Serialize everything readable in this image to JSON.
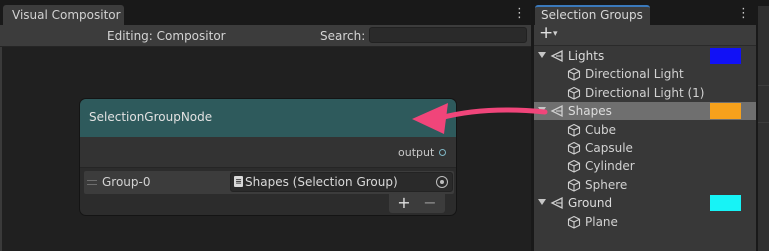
{
  "compositor": {
    "tab_label": "Visual Compositor",
    "menu_icon": "kebab-icon",
    "editing_label": "Editing: Compositor",
    "search_label": "Search:",
    "search_value": "",
    "node": {
      "title": "SelectionGroupNode",
      "output_label": "output",
      "group_label": "Group-0",
      "field_value": "Shapes (Selection Group)",
      "add_label": "+",
      "remove_label": "−"
    }
  },
  "selection_groups": {
    "tab_label": "Selection Groups",
    "menu_icon": "kebab-icon",
    "add_label": "+",
    "add_caret": "▾",
    "groups": [
      {
        "label": "Lights",
        "color": "#1111f6",
        "selected": false,
        "items": [
          "Directional Light",
          "Directional Light (1)"
        ]
      },
      {
        "label": "Shapes",
        "color": "#f6a11c",
        "selected": true,
        "items": [
          "Cube",
          "Capsule",
          "Cylinder",
          "Sphere"
        ]
      },
      {
        "label": "Ground",
        "color": "#17f3f6",
        "selected": false,
        "items": [
          "Plane"
        ]
      }
    ]
  },
  "colors": {
    "node_header": "#2e5a5c",
    "arrow": "#f0457a",
    "selection_row": "#6f6f6f",
    "tab_accent": "#3a79bb"
  }
}
